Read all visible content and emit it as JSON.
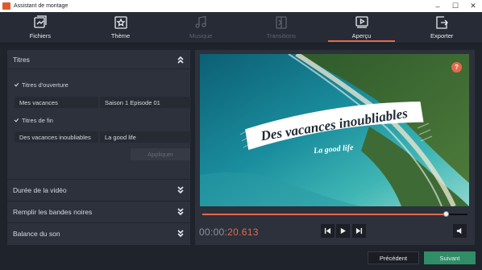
{
  "window": {
    "title": "Assistant de montage",
    "controls": [
      "–",
      "☐",
      "✕"
    ]
  },
  "tabs": [
    {
      "label": "Fichiers",
      "icon": "files-icon",
      "state": "normal"
    },
    {
      "label": "Thème",
      "icon": "theme-star-icon",
      "state": "normal"
    },
    {
      "label": "Musique",
      "icon": "music-note-icon",
      "state": "disabled"
    },
    {
      "label": "Transitions",
      "icon": "transitions-icon",
      "state": "disabled"
    },
    {
      "label": "Aperçu",
      "icon": "preview-play-icon",
      "state": "active"
    },
    {
      "label": "Exporter",
      "icon": "export-icon",
      "state": "normal"
    }
  ],
  "titles": {
    "header": "Titres",
    "opening_label": "Titres d'ouverture",
    "opening_checked": true,
    "opening_text_1": "Mes vacances",
    "opening_text_2": "Saison 1 Episode 01",
    "ending_label": "Titres de fin",
    "ending_checked": true,
    "ending_text_1": "Des vacances inoubliables",
    "ending_text_2": "La good life",
    "apply_label": "Appliquer"
  },
  "sections": [
    {
      "label": "Durée de la vidéo"
    },
    {
      "label": "Remplir les bandes noires"
    },
    {
      "label": "Balance du son"
    }
  ],
  "preview": {
    "overlay_title": "Des vacances inoubliables",
    "overlay_subtitle": "La good life",
    "help_label": "?",
    "progress": 0.92,
    "time_static": "00:00:",
    "time_active": "20.613"
  },
  "footer": {
    "prev_label": "Précédent",
    "next_label": "Suivant"
  },
  "colors": {
    "accent": "#e36a4e",
    "next_button": "#2f8d67",
    "panel": "#2c313b"
  }
}
